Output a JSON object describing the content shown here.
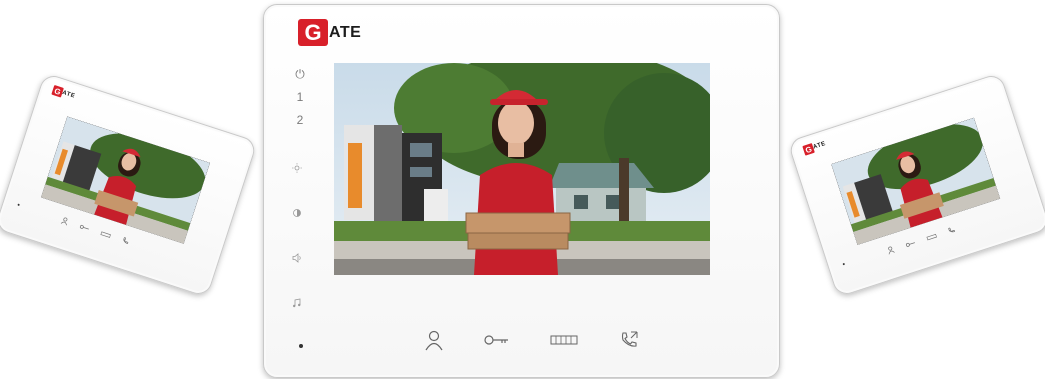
{
  "brand": {
    "g": "G",
    "rest": "ATE",
    "accent": "#d8202a"
  },
  "side_keys": [
    "⏻",
    "1",
    "2"
  ],
  "icons": {
    "side": [
      "brightness-icon",
      "contrast-icon",
      "volume-icon",
      "ringtone-icon"
    ],
    "bottom": [
      "monitor-person-icon",
      "unlock-key-icon",
      "gate-icon",
      "answer-call-icon"
    ]
  }
}
